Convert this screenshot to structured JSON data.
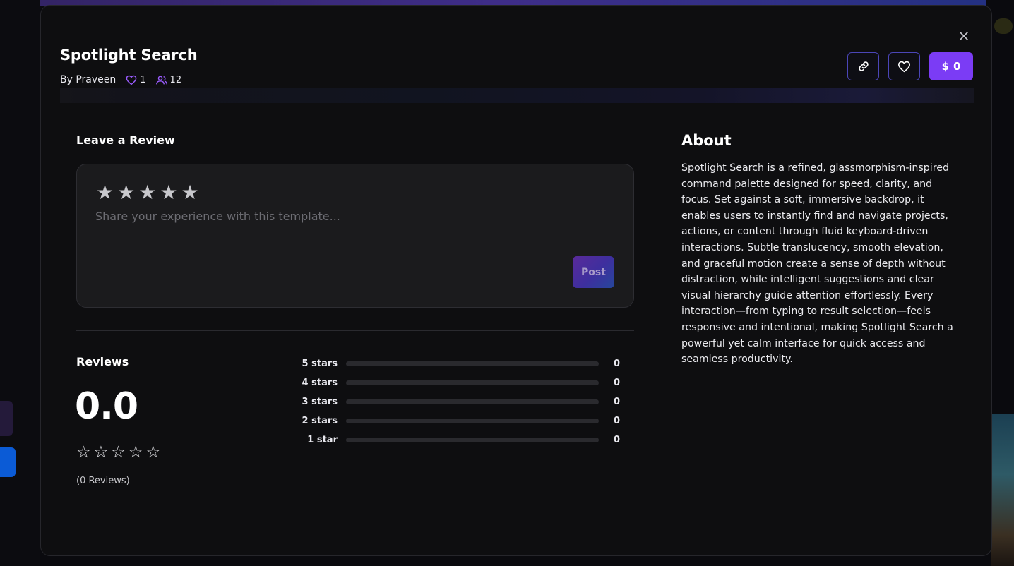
{
  "template": {
    "title": "Spotlight Search",
    "author_label": "By Praveen",
    "likes": "1",
    "users": "12",
    "price": "0",
    "price_symbol": "$"
  },
  "icons": {
    "close": "close-icon",
    "link": "link-icon",
    "like": "heart-icon",
    "users": "users-icon",
    "price": "dollar-icon"
  },
  "colors": {
    "accent": "#7b3cf5",
    "outline": "#4b46b8",
    "background": "#0e0e10"
  },
  "leave_review": {
    "heading": "Leave a Review",
    "placeholder": "Share your experience with this template...",
    "post_label": "Post",
    "star_count": 5
  },
  "reviews": {
    "heading": "Reviews",
    "average": "0.0",
    "count_label": "(0 Reviews)",
    "distribution": [
      {
        "label": "5 stars",
        "count": "0",
        "fraction": 0
      },
      {
        "label": "4 stars",
        "count": "0",
        "fraction": 0
      },
      {
        "label": "3 stars",
        "count": "0",
        "fraction": 0
      },
      {
        "label": "2 stars",
        "count": "0",
        "fraction": 0
      },
      {
        "label": "1 star",
        "count": "0",
        "fraction": 0
      }
    ]
  },
  "about": {
    "heading": "About",
    "body": "Spotlight Search is a refined, glassmorphism-inspired command palette designed for speed, clarity, and focus. Set against a soft, immersive backdrop, it enables users to instantly find and navigate projects, actions, or content through fluid keyboard-driven interactions. Subtle translucency, smooth elevation, and graceful motion create a sense of depth without distraction, while intelligent suggestions and clear visual hierarchy guide attention effortlessly. Every interaction—from typing to result selection—feels responsive and intentional, making Spotlight Search a powerful yet calm interface for quick access and seamless productivity."
  }
}
